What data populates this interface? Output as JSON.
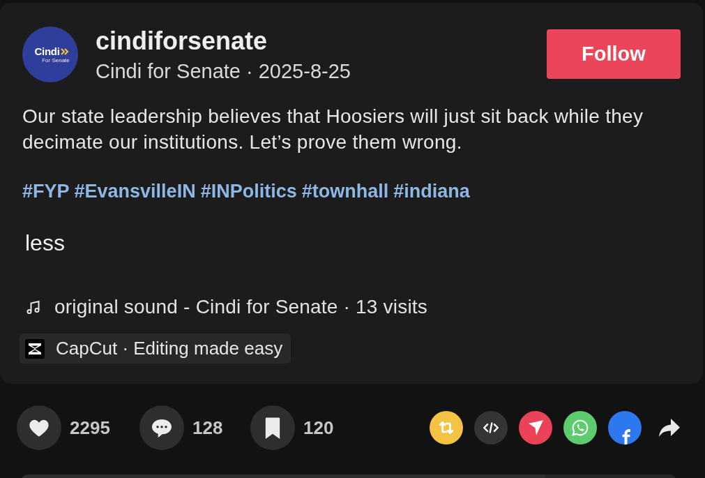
{
  "post": {
    "author": {
      "avatar": {
        "wordmark": "Cindi",
        "tagline": "For Senate"
      },
      "username": "cindiforsenate",
      "byline": "Cindi for Senate · 2025-8-25"
    },
    "follow_button": "Follow",
    "description": "Our state leadership believes that Hoosiers will just sit back while they decimate our institutions. Let’s prove them wrong.",
    "hashtags": [
      "#FYP",
      "#EvansvilleIN",
      "#INPolitics",
      "#townhall",
      "#indiana"
    ],
    "collapse_link": "less",
    "sound": "original sound - Cindi for Senate · 13 visits",
    "app_tag": "CapCut · Editing made easy"
  },
  "stats": [
    {
      "kind": "like",
      "count": "2295"
    },
    {
      "kind": "comment",
      "count": "128"
    },
    {
      "kind": "save",
      "count": "120"
    }
  ],
  "share_buttons": [
    {
      "kind": "repost"
    },
    {
      "kind": "embed"
    },
    {
      "kind": "send"
    },
    {
      "kind": "chat"
    },
    {
      "kind": "social"
    },
    {
      "kind": "forward"
    }
  ]
}
